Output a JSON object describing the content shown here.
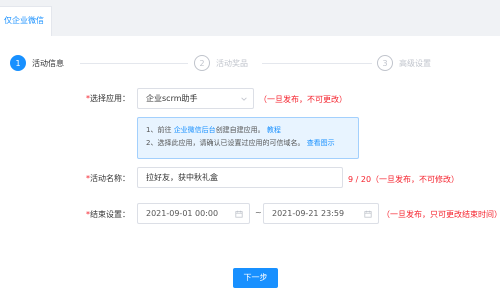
{
  "tabbar": {
    "tab_label": "仅企业微信"
  },
  "steps": [
    {
      "num": "1",
      "title": "活动信息"
    },
    {
      "num": "2",
      "title": "活动奖品"
    },
    {
      "num": "3",
      "title": "高级设置"
    }
  ],
  "form": {
    "required_mark": "*",
    "app": {
      "label": "选择应用：",
      "value": "企业scrm助手",
      "tip": "（一旦发布，不可更改）"
    },
    "note": {
      "line1_prefix": "1、前往 ",
      "line1_link": "企业微信后台",
      "line1_middle": "创建自建应用。",
      "line1_link2": "教程",
      "line2_text": "2、选择此应用，请确认已设置过应用的可信域名。",
      "line2_link": "查看图示"
    },
    "name": {
      "label": "活动名称：",
      "value": "拉好友，获中秋礼盒",
      "counter": "9 / 20（一旦发布，不可修改）"
    },
    "end": {
      "label": "结束设置：",
      "start": "2021-09-01 00:00",
      "separator": "~",
      "end": "2021-09-21 23:59",
      "tip": "（一旦发布，只可更改结束时间）"
    }
  },
  "footer": {
    "next_label": "下一步"
  },
  "colors": {
    "primary": "#1890ff",
    "danger": "#f5222d",
    "note_bg": "#e8f4ff"
  }
}
